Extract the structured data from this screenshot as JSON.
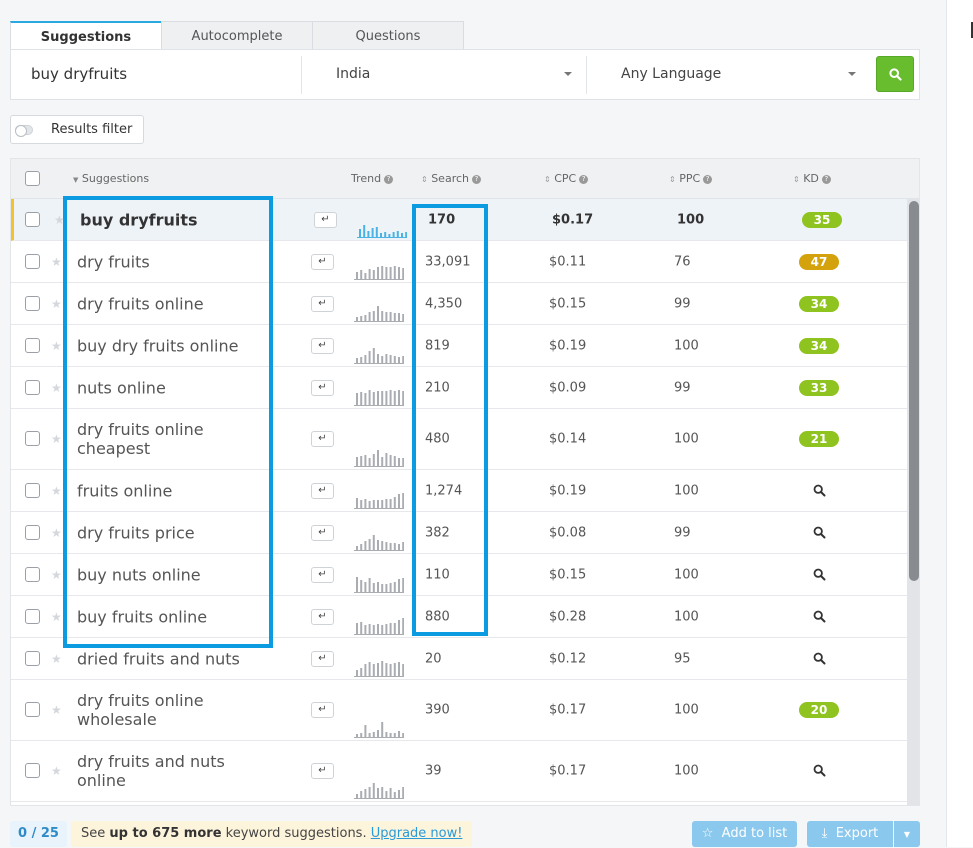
{
  "tabs": [
    {
      "label": "Suggestions",
      "active": true
    },
    {
      "label": "Autocomplete",
      "active": false
    },
    {
      "label": "Questions",
      "active": false
    }
  ],
  "search": {
    "query": "buy dryfruits",
    "location": "India",
    "language": "Any Language"
  },
  "results_filter_label": "Results filter",
  "columns": {
    "suggestions": "Suggestions",
    "trend": "Trend",
    "search": "Search",
    "cpc": "CPC",
    "ppc": "PPC",
    "kd": "KD"
  },
  "rows": [
    {
      "keyword": "buy dryfruits",
      "search": "170",
      "cpc": "$0.17",
      "ppc": "100",
      "kd": "35",
      "trend": [
        8,
        12,
        6,
        9,
        10,
        4,
        5,
        3,
        5,
        6,
        4,
        5
      ],
      "trend_color": "#4ab3e3"
    },
    {
      "keyword": "dry fruits",
      "search": "33,091",
      "cpc": "$0.11",
      "ppc": "76",
      "kd": "47",
      "trend": [
        7,
        9,
        6,
        10,
        9,
        12,
        13,
        12,
        12,
        13,
        12,
        11
      ],
      "trend_color": "#a9adb2"
    },
    {
      "keyword": "dry fruits online",
      "search": "4,350",
      "cpc": "$0.15",
      "ppc": "99",
      "kd": "34",
      "trend": [
        4,
        5,
        6,
        9,
        10,
        15,
        10,
        9,
        9,
        8,
        8,
        7
      ],
      "trend_color": "#a9adb2"
    },
    {
      "keyword": "buy dry fruits online",
      "search": "819",
      "cpc": "$0.19",
      "ppc": "100",
      "kd": "34",
      "trend": [
        5,
        6,
        8,
        12,
        15,
        9,
        7,
        9,
        8,
        7,
        6,
        7
      ],
      "trend_color": "#a9adb2"
    },
    {
      "keyword": "nuts online",
      "search": "210",
      "cpc": "$0.09",
      "ppc": "99",
      "kd": "33",
      "trend": [
        12,
        13,
        12,
        15,
        13,
        14,
        14,
        14,
        15,
        14,
        15,
        14
      ],
      "trend_color": "#a9adb2"
    },
    {
      "keyword": "dry fruits online cheapest",
      "search": "480",
      "cpc": "$0.14",
      "ppc": "100",
      "kd": "21",
      "trend": [
        9,
        10,
        11,
        8,
        12,
        16,
        9,
        13,
        11,
        10,
        8,
        8
      ],
      "trend_color": "#a9adb2"
    },
    {
      "keyword": "fruits online",
      "search": "1,274",
      "cpc": "$0.19",
      "ppc": "100",
      "kd": "",
      "trend": [
        10,
        8,
        9,
        7,
        8,
        8,
        8,
        9,
        9,
        11,
        14,
        15
      ],
      "trend_color": "#a9adb2"
    },
    {
      "keyword": "dry fruits price",
      "search": "382",
      "cpc": "$0.08",
      "ppc": "99",
      "kd": "",
      "trend": [
        4,
        6,
        9,
        11,
        15,
        10,
        9,
        8,
        7,
        7,
        6,
        8
      ],
      "trend_color": "#a9adb2"
    },
    {
      "keyword": "buy nuts online",
      "search": "110",
      "cpc": "$0.15",
      "ppc": "100",
      "kd": "",
      "trend": [
        15,
        12,
        10,
        14,
        9,
        10,
        8,
        8,
        9,
        10,
        13,
        14
      ],
      "trend_color": "#a9adb2"
    },
    {
      "keyword": "buy fruits online",
      "search": "880",
      "cpc": "$0.28",
      "ppc": "100",
      "kd": "",
      "trend": [
        11,
        12,
        9,
        10,
        9,
        10,
        9,
        10,
        11,
        11,
        14,
        16
      ],
      "trend_color": "#a9adb2"
    },
    {
      "keyword": "dried fruits and nuts",
      "search": "20",
      "cpc": "$0.12",
      "ppc": "95",
      "kd": "",
      "trend": [
        6,
        8,
        12,
        14,
        12,
        13,
        15,
        13,
        12,
        13,
        14,
        12
      ],
      "trend_color": "#a9adb2"
    },
    {
      "keyword": "dry fruits online wholesale",
      "search": "390",
      "cpc": "$0.17",
      "ppc": "100",
      "kd": "20",
      "trend": [
        3,
        4,
        12,
        4,
        5,
        7,
        15,
        5,
        4,
        4,
        6,
        4
      ],
      "trend_color": "#a9adb2"
    },
    {
      "keyword": "dry fruits and nuts online",
      "search": "39",
      "cpc": "$0.17",
      "ppc": "100",
      "kd": "",
      "trend": [
        4,
        7,
        9,
        11,
        15,
        10,
        11,
        7,
        10,
        6,
        8,
        11
      ],
      "trend_color": "#a9adb2"
    }
  ],
  "footer": {
    "count": "0 / 25",
    "msg_prefix": "See ",
    "msg_bold": "up to 675 more",
    "msg_suffix": " keyword suggestions. ",
    "upgrade_link": "Upgrade now!",
    "add_to_list": "Add to list",
    "export": "Export"
  },
  "colors": {
    "accent_blue": "#29a9df",
    "highlight_box": "#0a9be0",
    "search_button": "#67bd2e",
    "kd_easy": "#8fc31f",
    "kd_medium": "#d4a20c"
  }
}
